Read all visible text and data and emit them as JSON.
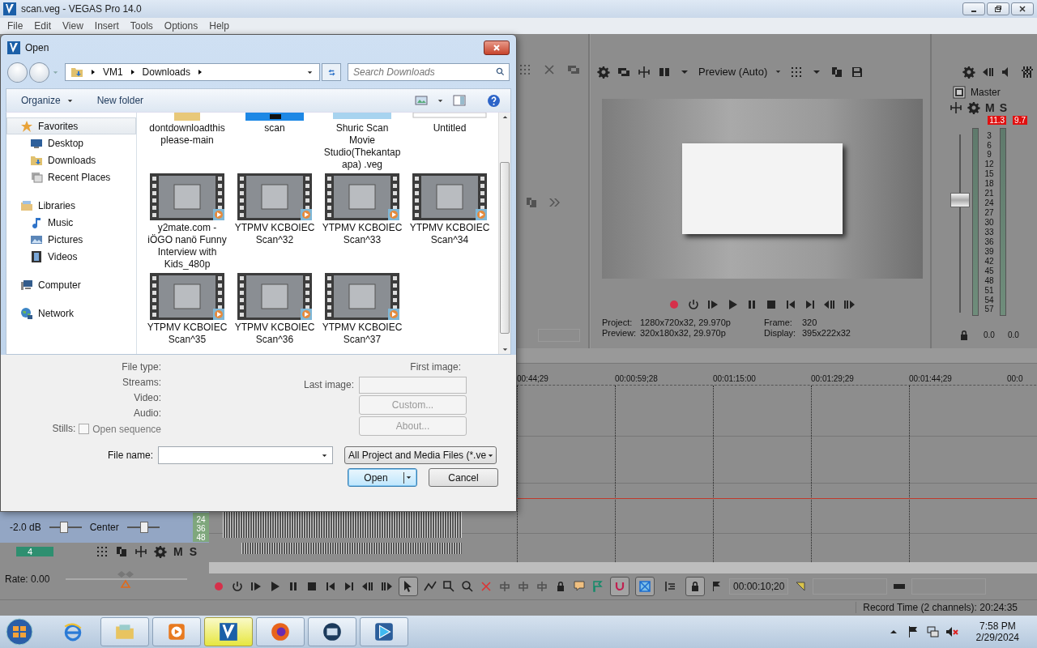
{
  "app": {
    "title": "scan.veg - VEGAS Pro 14.0",
    "menu": [
      "File",
      "Edit",
      "View",
      "Insert",
      "Tools",
      "Options",
      "Help"
    ]
  },
  "dialog": {
    "title": "Open",
    "path": [
      "VM1",
      "Downloads"
    ],
    "search": {
      "placeholder": "Search Downloads"
    },
    "toolbar": [
      "Organize",
      "New folder"
    ],
    "nav": [
      {
        "label": "Favorites",
        "kind": "favorites",
        "selected": true,
        "children": [
          {
            "label": "Desktop",
            "kind": "desktop",
            "selected": false
          },
          {
            "label": "Downloads",
            "kind": "downloads",
            "selected": false
          },
          {
            "label": "Recent Places",
            "kind": "recent",
            "selected": false
          }
        ]
      },
      {
        "label": "Libraries",
        "kind": "libraries",
        "selected": false,
        "children": [
          {
            "label": "Music",
            "kind": "music",
            "selected": false
          },
          {
            "label": "Pictures",
            "kind": "pictures",
            "selected": false
          },
          {
            "label": "Videos",
            "kind": "videos",
            "selected": false
          }
        ]
      },
      {
        "label": "Computer",
        "kind": "computer",
        "selected": false
      },
      {
        "label": "Network",
        "kind": "network",
        "selected": false
      }
    ],
    "rows": [
      [
        {
          "name": "dontdownloadthisplease-main",
          "kind": "folder"
        },
        {
          "name": "scan",
          "kind": "image"
        },
        {
          "name": "Shuric Scan Movie Studio(Thekantapapa) .veg",
          "kind": "project"
        },
        {
          "name": "Untitled",
          "kind": "blank"
        }
      ],
      [
        {
          "name": "y2mate.com - iÖGO nanö Funny Interview with Kids_480p",
          "kind": "video"
        },
        {
          "name": "YTPMV KCBOIEC Scan^32",
          "kind": "video"
        },
        {
          "name": "YTPMV KCBOIEC Scan^33",
          "kind": "video"
        },
        {
          "name": "YTPMV KCBOIEC Scan^34",
          "kind": "video"
        }
      ],
      [
        {
          "name": "YTPMV KCBOIEC Scan^35",
          "kind": "video"
        },
        {
          "name": "YTPMV KCBOIEC Scan^36",
          "kind": "video"
        },
        {
          "name": "YTPMV KCBOIEC Scan^37",
          "kind": "video"
        }
      ]
    ],
    "details": {
      "labels": [
        "File type:",
        "Streams:",
        "Video:",
        "Audio:"
      ],
      "stills": "Stills:",
      "open_sequence": {
        "label": "Open sequence",
        "checked": false
      },
      "first_image": "First image:",
      "last_image": "Last image:",
      "buttons": [
        {
          "label": "Custom...",
          "disabled": true
        },
        {
          "label": "About...",
          "disabled": true
        }
      ]
    },
    "file_name": {
      "label": "File name:"
    },
    "filter": "All Project and Media Files (*.ve",
    "actions": [
      {
        "label": "Open",
        "kind": "split",
        "default": true
      },
      {
        "label": "Cancel",
        "kind": "plain",
        "default": false
      }
    ]
  },
  "preview": {
    "mode": "Preview (Auto)",
    "info": [
      {
        "label": "Project:",
        "value": "1280x720x32, 29.970p"
      },
      {
        "label": "Preview:",
        "value": "320x180x32, 29.970p"
      },
      {
        "label": "Frame:",
        "value": "320"
      },
      {
        "label": "Display:",
        "value": "395x222x32"
      }
    ]
  },
  "mixer": {
    "title": "Master",
    "mute": "M",
    "solo": "S",
    "peaks": [
      "11.3",
      "9.7"
    ],
    "scale": [
      "3",
      "6",
      "9",
      "12",
      "15",
      "18",
      "21",
      "24",
      "27",
      "30",
      "33",
      "36",
      "39",
      "42",
      "45",
      "48",
      "51",
      "54",
      "57"
    ],
    "readings": [
      "0.0",
      "0.0"
    ],
    "fader": {
      "level": 0.63
    }
  },
  "track": {
    "volume": "-2.0 dB",
    "volume_fader": {
      "level": 0.45
    },
    "pan": "Center",
    "pan_fader": {
      "level": 0.55
    },
    "rate_slider": {
      "level": 0.49
    },
    "meter_scale": [
      "24",
      "36",
      "48"
    ],
    "number": "4",
    "mute": "M",
    "solo": "S",
    "rate": "Rate: 0.00"
  },
  "timeline": {
    "ruler": [
      "00:44;29",
      "00:00:59;28",
      "00:01:15:00",
      "00:01:29;29",
      "00:01:44;29",
      "00:0"
    ]
  },
  "transport": {
    "time": "00:00:10;20",
    "toggles": [
      {
        "kind": "edit-tool",
        "on": true
      },
      {
        "kind": "snapping",
        "on": true
      },
      {
        "kind": "crossfade",
        "on": true
      },
      {
        "kind": "ripple",
        "on": false
      },
      {
        "kind": "lock-envelopes",
        "on": true
      }
    ]
  },
  "status": "Record Time (2 channels): 20:24:35",
  "taskbar": {
    "apps": [
      {
        "kind": "browser",
        "selected": false
      },
      {
        "kind": "folder",
        "selected": false
      },
      {
        "kind": "media",
        "selected": false
      },
      {
        "kind": "editor",
        "selected": true
      },
      {
        "kind": "firefox",
        "selected": false
      },
      {
        "kind": "film",
        "selected": false
      },
      {
        "kind": "player",
        "selected": false
      }
    ],
    "clock": {
      "time": "7:58 PM",
      "date": "2/29/2024"
    }
  }
}
